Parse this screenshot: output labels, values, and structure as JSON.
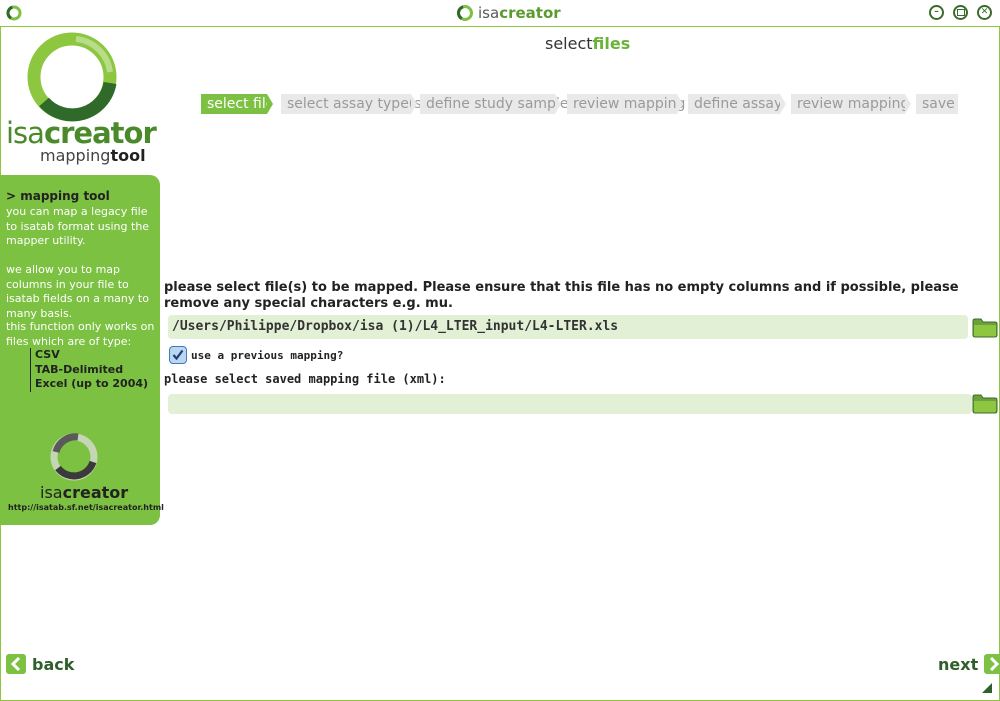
{
  "window": {
    "title_part1": "isa",
    "title_part2": "creator",
    "controls": [
      "minimize",
      "maximize",
      "close"
    ]
  },
  "brand": {
    "name_part1": "isa",
    "name_part2": "creator",
    "sub_part1": "mapping",
    "sub_part2": "tool"
  },
  "info_panel": {
    "heading": "> mapping tool",
    "para1": "you can map a legacy file to isatab format using the mapper utility.",
    "para2": "we allow you to map columns in your file to isatab fields on a many to many basis.",
    "para3": "this function only works on files which are of type:",
    "types": [
      "CSV",
      "TAB-Delimited",
      "Excel (up to 2004)"
    ],
    "footer_brand_part1": "isa",
    "footer_brand_part2": "creator",
    "url": "http://isatab.sf.net/isacreator.html"
  },
  "page": {
    "title_part1": "select",
    "title_part2": "files"
  },
  "steps": [
    {
      "label": "select file",
      "active": true
    },
    {
      "label": "select assay type(s)",
      "active": false
    },
    {
      "label": "define study sample",
      "active": false
    },
    {
      "label": "review mapping",
      "active": false
    },
    {
      "label": "define assay",
      "active": false
    },
    {
      "label": "review mapping",
      "active": false
    },
    {
      "label": "save",
      "active": false
    }
  ],
  "form": {
    "prompt": "please select file(s) to be mapped. Please ensure that this file has no empty columns and if possible, please remove any special characters e.g. mu.",
    "file_path": "/Users/Philippe/Dropbox/isa (1)/L4_LTER_input/L4-LTER.xls",
    "use_previous_label": "use a previous mapping?",
    "use_previous_checked": true,
    "saved_mapping_label": "please select saved mapping file (xml):",
    "saved_mapping_value": ""
  },
  "nav": {
    "back_label": "back",
    "next_label": "next"
  },
  "colors": {
    "accent": "#7cc142",
    "dark_green": "#2f5f2a",
    "field_bg": "#e2f0d6"
  }
}
